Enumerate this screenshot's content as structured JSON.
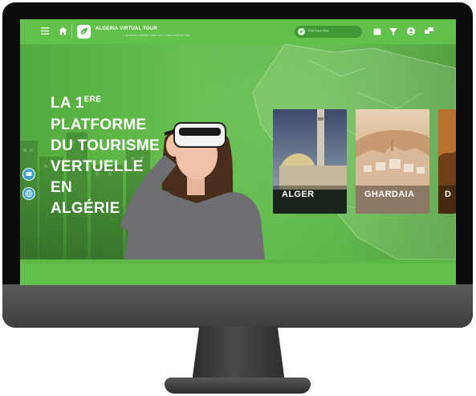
{
  "header": {
    "brand": "ALGERIA VIRTUAL TOUR",
    "brand_sub": "L'ALGÉRIE COMME VOUS NE L'AVEZ JAMAIS VUE",
    "search_placeholder": "Rechercher"
  },
  "hero": {
    "line1_main": "LA 1",
    "line1_sup": "ERE",
    "line2": "PLATFORME",
    "line3": "DU TOURISME",
    "line4": "VERTUELLE",
    "line5": "EN",
    "line6": "ALGÉRIE"
  },
  "cards": [
    {
      "label": "ALGER"
    },
    {
      "label": "GHARDAIA"
    },
    {
      "label": "D"
    }
  ],
  "icons": {
    "menu": "hamburger-icon",
    "home": "home-icon",
    "logo": "leaf-logo-icon",
    "search": "compass-icon",
    "calendar": "calendar-icon",
    "filter": "funnel-icon",
    "account": "user-icon",
    "chat": "chat-icon",
    "side_message": "message-icon",
    "side_globe": "globe-icon"
  },
  "colors": {
    "brand_green": "#62c14a",
    "hero_green": "#5cb846",
    "search_bg": "#3f9935",
    "text": "#ffffff",
    "accent_blue": "#3aa2c8"
  }
}
